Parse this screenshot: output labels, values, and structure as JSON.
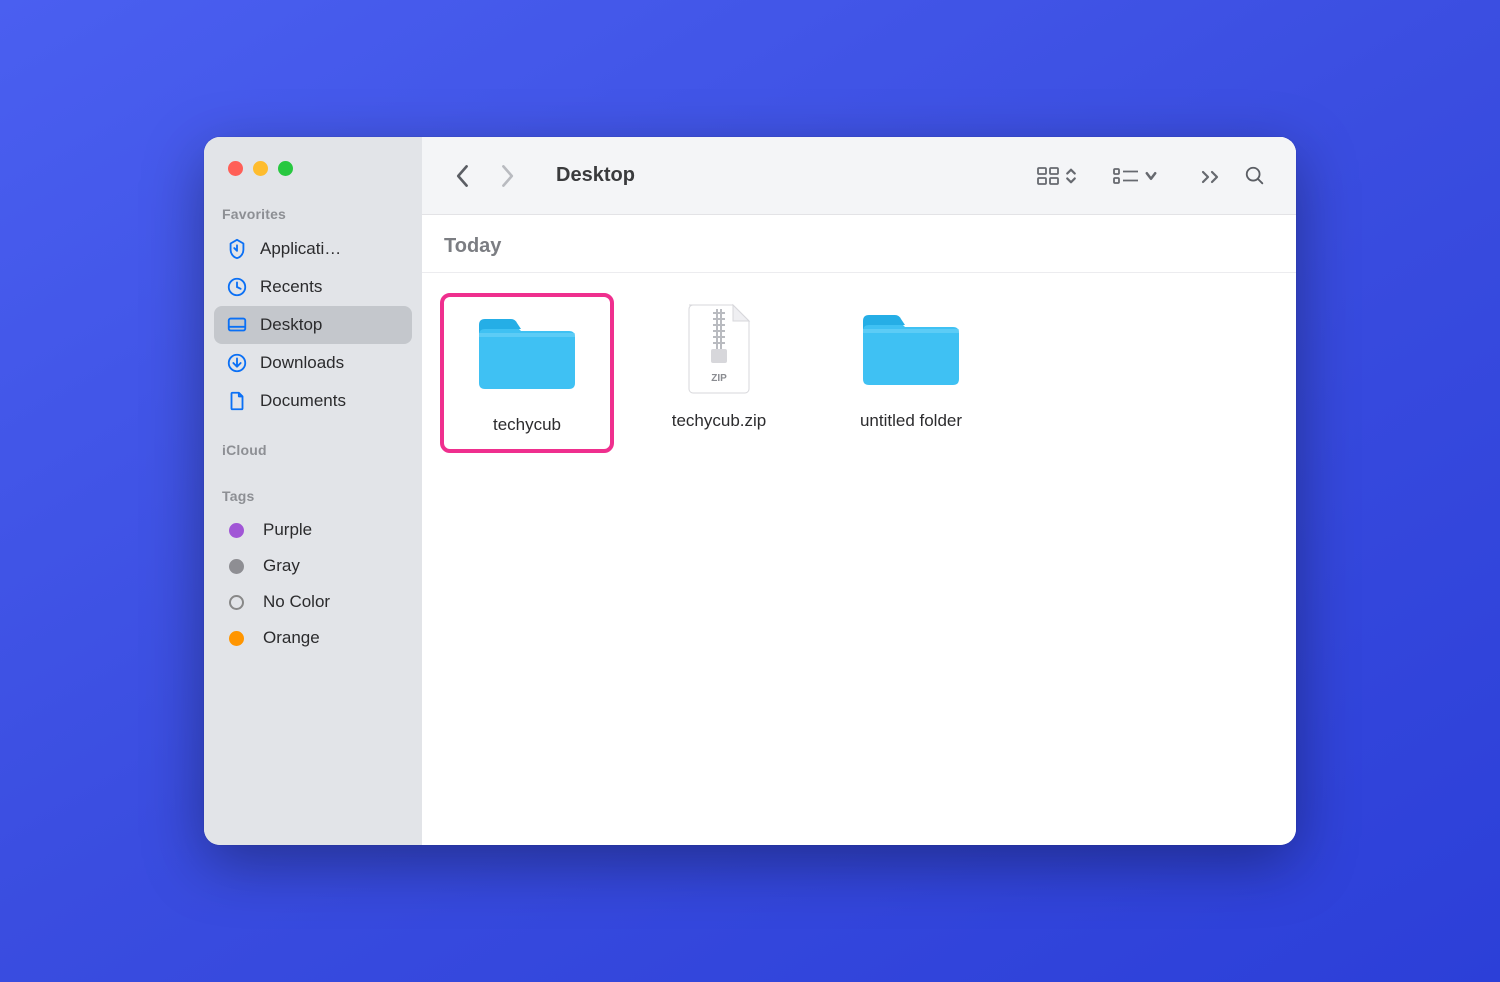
{
  "window_title": "Desktop",
  "sidebar": {
    "favorites_heading": "Favorites",
    "favorites": [
      {
        "icon": "applications-icon",
        "label": "Applicati…"
      },
      {
        "icon": "recents-icon",
        "label": "Recents"
      },
      {
        "icon": "desktop-icon",
        "label": "Desktop",
        "active": true
      },
      {
        "icon": "downloads-icon",
        "label": "Downloads"
      },
      {
        "icon": "documents-icon",
        "label": "Documents"
      }
    ],
    "icloud_heading": "iCloud",
    "tags_heading": "Tags",
    "tags": [
      {
        "label": "Purple",
        "color": "#a156d6"
      },
      {
        "label": "Gray",
        "color": "#8e8e93"
      },
      {
        "label": "No Color",
        "color": "nocolor"
      },
      {
        "label": "Orange",
        "color": "#ff9500"
      }
    ]
  },
  "content": {
    "group_heading": "Today",
    "items": [
      {
        "type": "folder",
        "label": "techycub",
        "highlighted": true
      },
      {
        "type": "zip",
        "label": "techycub.zip",
        "highlighted": false
      },
      {
        "type": "folder",
        "label": "untitled folder",
        "highlighted": false
      }
    ]
  }
}
